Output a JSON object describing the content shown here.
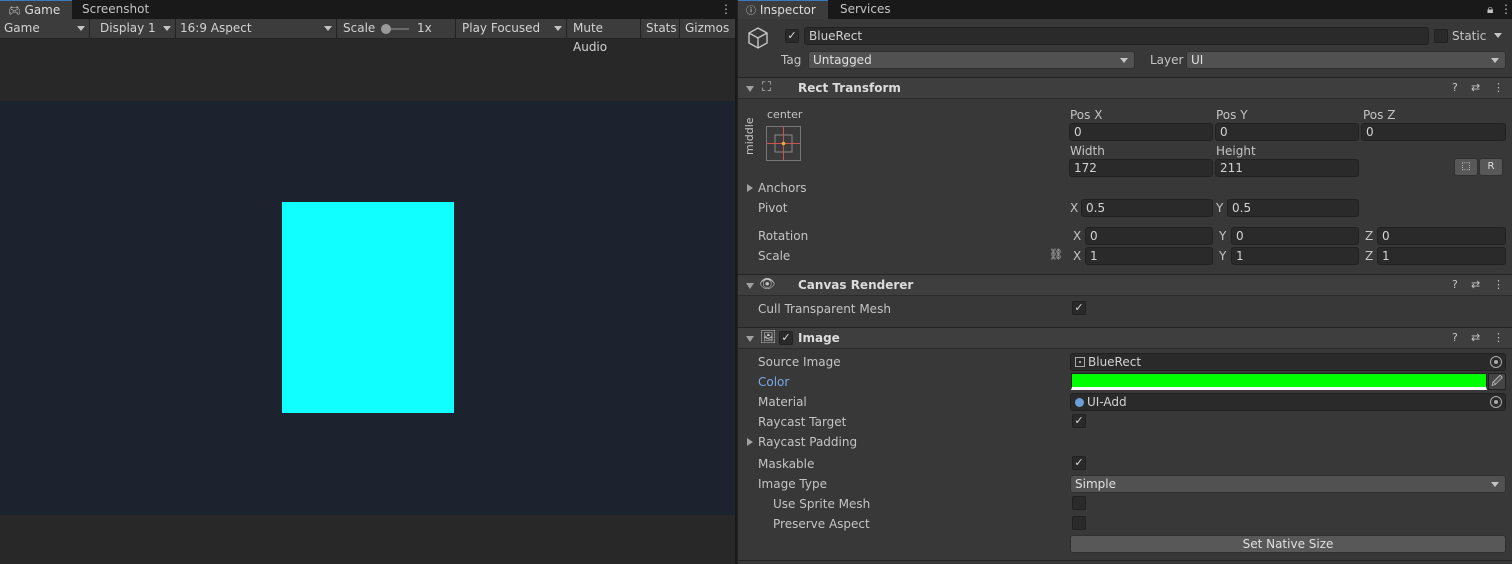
{
  "game_panel": {
    "tabs": [
      {
        "label": "Game",
        "icon": "gamepad-icon"
      },
      {
        "label": "Screenshot"
      }
    ],
    "toolbar": {
      "mode": "Game",
      "display": "Display 1",
      "aspect": "16:9 Aspect",
      "scale_label": "Scale",
      "scale_value": "1x",
      "play_mode": "Play Focused",
      "mute_audio": "Mute Audio",
      "stats": "Stats",
      "gizmos": "Gizmos"
    },
    "rect_color": "#10ffff",
    "view_bg": "#1c222e"
  },
  "inspector": {
    "tabs": [
      {
        "label": "Inspector",
        "icon": "info-icon"
      },
      {
        "label": "Services"
      }
    ],
    "object": {
      "active": true,
      "name": "BlueRect",
      "static_label": "Static",
      "tag_label": "Tag",
      "tag_value": "Untagged",
      "layer_label": "Layer",
      "layer_value": "UI"
    },
    "rect_transform": {
      "title": "Rect Transform",
      "anchor_h": "center",
      "anchor_v": "middle",
      "pos_x_label": "Pos X",
      "pos_x": "0",
      "pos_y_label": "Pos Y",
      "pos_y": "0",
      "pos_z_label": "Pos Z",
      "pos_z": "0",
      "width_label": "Width",
      "width": "172",
      "height_label": "Height",
      "height": "211",
      "r_button": "R",
      "anchors_label": "Anchors",
      "pivot_label": "Pivot",
      "pivot_x": "0.5",
      "pivot_y": "0.5",
      "rotation_label": "Rotation",
      "rot_x": "0",
      "rot_y": "0",
      "rot_z": "0",
      "scale_label": "Scale",
      "scale_x": "1",
      "scale_y": "1",
      "scale_z": "1",
      "x": "X",
      "y": "Y",
      "z": "Z"
    },
    "canvas_renderer": {
      "title": "Canvas Renderer",
      "cull_label": "Cull Transparent Mesh",
      "cull_checked": true
    },
    "image": {
      "title": "Image",
      "enabled": true,
      "source_image_label": "Source Image",
      "source_image": "BlueRect",
      "color_label": "Color",
      "color": "#00ff00",
      "material_label": "Material",
      "material": "UI-Add",
      "raycast_target_label": "Raycast Target",
      "raycast_target": true,
      "raycast_padding_label": "Raycast Padding",
      "maskable_label": "Maskable",
      "maskable": true,
      "image_type_label": "Image Type",
      "image_type": "Simple",
      "use_sprite_mesh_label": "Use Sprite Mesh",
      "preserve_aspect_label": "Preserve Aspect",
      "set_native_size": "Set Native Size"
    }
  }
}
